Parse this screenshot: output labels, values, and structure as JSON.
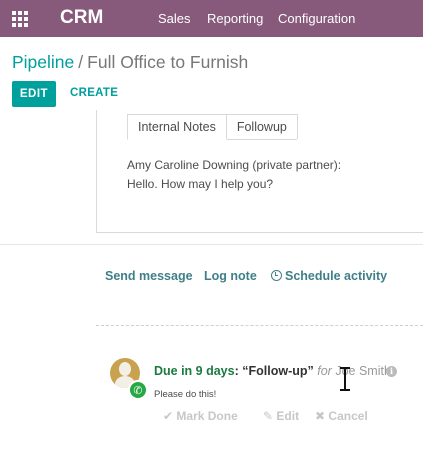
{
  "topbar": {
    "brand": "CRM",
    "menu": [
      "Sales",
      "Reporting",
      "Configuration"
    ],
    "background": "#875a7b"
  },
  "breadcrumb": {
    "parent": "Pipeline",
    "separator": "/",
    "current": "Full Office to Furnish"
  },
  "actions": {
    "edit_label": "EDIT",
    "create_label": "CREATE"
  },
  "tabs": [
    "Internal Notes",
    "Followup"
  ],
  "note": {
    "author_line": "Amy Caroline Downing (private partner):",
    "message": "Hello. How may I help you?"
  },
  "chatter": {
    "send_message": "Send message",
    "log_note": "Log note",
    "schedule_activity": "Schedule activity"
  },
  "activity": {
    "due": "Due in 9 days",
    "colon": ":",
    "summary": "“Follow-up”",
    "for_label": "for",
    "assignee": "Joe Smith",
    "note": "Please do this!",
    "mark_done": "Mark Done",
    "edit": "Edit",
    "cancel": "Cancel",
    "type_icon": "phone-icon"
  },
  "colors": {
    "accent": "#00a09d",
    "link": "#3f7f87",
    "due_green": "#1b7a3f",
    "phone_badge": "#28a745"
  }
}
